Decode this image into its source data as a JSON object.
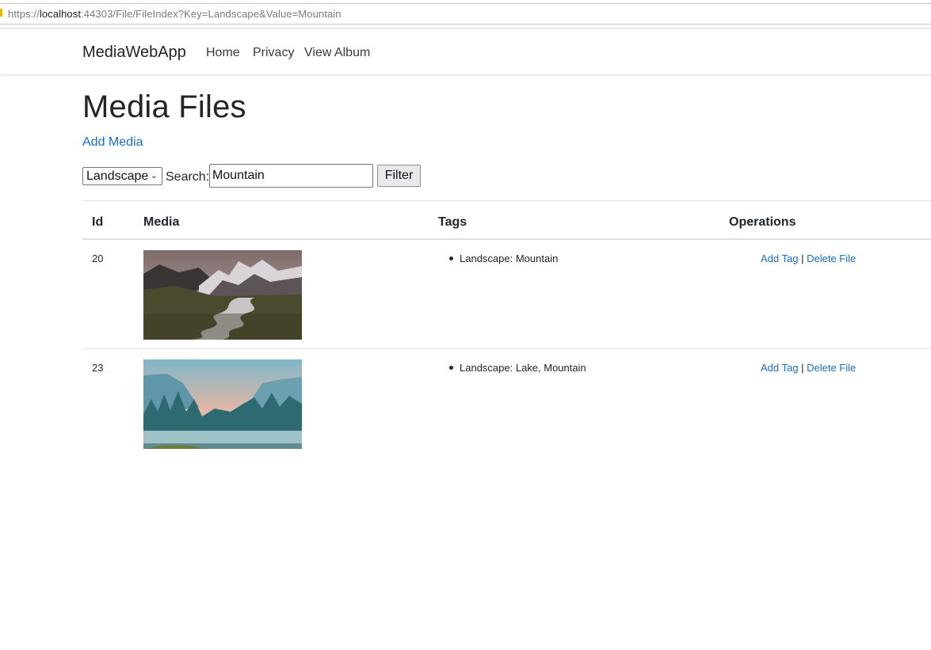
{
  "browser": {
    "url_prefix": "https://",
    "url_host": "localhost",
    "url_rest": ":44303/File/FileIndex?Key=Landscape&Value=Mountain"
  },
  "nav": {
    "brand": "MediaWebApp",
    "links": [
      "Home",
      "Privacy",
      "View Album"
    ]
  },
  "page": {
    "title": "Media Files",
    "add_media": "Add Media"
  },
  "filter": {
    "selected_key": "Landscape",
    "search_label": "Search:",
    "search_value": "Mountain",
    "button_label": "Filter"
  },
  "table": {
    "headers": [
      "Id",
      "Media",
      "Tags",
      "Operations"
    ],
    "rows": [
      {
        "id": "20",
        "image": "mountain-river-photo",
        "tags": [
          "Landscape: Mountain"
        ],
        "add_tag": "Add Tag",
        "separator": "|",
        "delete_file": "Delete File"
      },
      {
        "id": "23",
        "image": "forest-lake-valley-photo",
        "tags": [
          "Landscape: Lake, Mountain"
        ],
        "add_tag": "Add Tag",
        "separator": "|",
        "delete_file": "Delete File"
      }
    ]
  },
  "colors": {
    "link": "#1b6ec2",
    "text": "#212529",
    "border": "#dee2e6"
  }
}
